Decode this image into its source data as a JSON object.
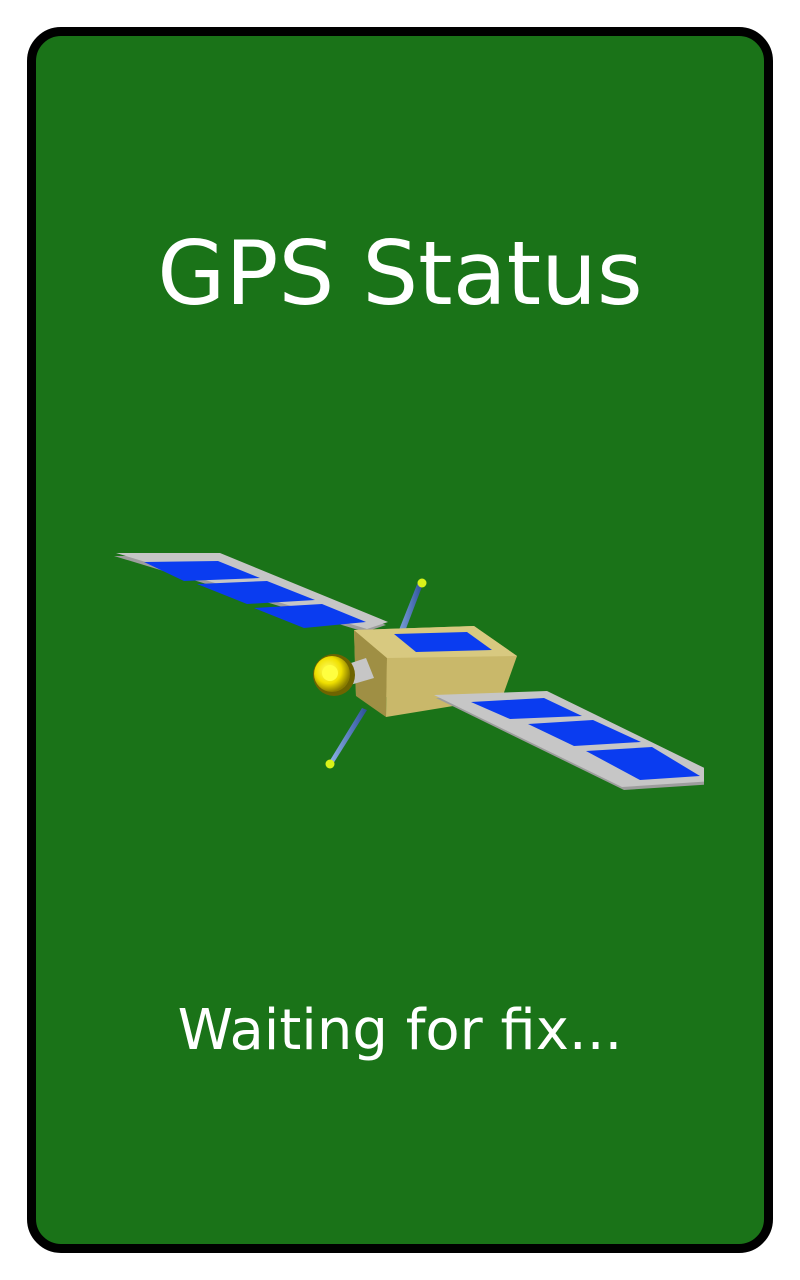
{
  "screen": {
    "title": "GPS Status",
    "status_text": "Waiting for fix...",
    "illustration": "satellite-icon"
  },
  "colors": {
    "background": "#ffffff",
    "card": "#1a7318",
    "card_border": "#000000",
    "text": "#ffffff",
    "panel_frame": "#c6c6c6",
    "solar_cell": "#0a3cf0",
    "satellite_body": "#c9b86a",
    "antenna_tip": "#d8f21a"
  }
}
